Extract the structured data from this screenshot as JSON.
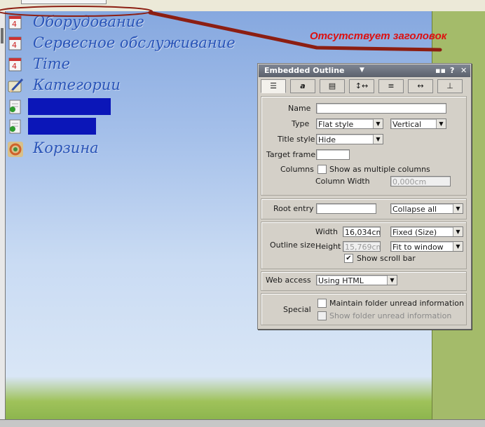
{
  "outline": {
    "items": [
      {
        "label": "Оборудование",
        "icon": "calendar-icon"
      },
      {
        "label": "Сервесное обслуживание",
        "icon": "calendar-icon"
      },
      {
        "label": "Time",
        "icon": "calendar-icon"
      },
      {
        "label": "Категории",
        "icon": "pencil-notebook-icon"
      },
      {
        "label": "",
        "icon": "document-pushpin-icon",
        "redacted": true
      },
      {
        "label": "",
        "icon": "document-pushpin-icon",
        "redacted": true
      },
      {
        "label": "Корзина",
        "icon": "trash-icon"
      }
    ]
  },
  "annotation": {
    "text": "Отсутствует заголовок",
    "color": "#dd1010"
  },
  "panel": {
    "title": "Embedded Outline",
    "tabs": [
      "outline-info-icon",
      "font-icon",
      "border-icon",
      "spacing-icon",
      "lines-icon",
      "width-icon",
      "hide-icon"
    ],
    "name": {
      "label": "Name",
      "value": ""
    },
    "type": {
      "label": "Type",
      "value": "Flat style",
      "orientation": "Vertical"
    },
    "title_style": {
      "label": "Title style",
      "value": "Hide"
    },
    "target_frame": {
      "label": "Target frame",
      "value": ""
    },
    "columns": {
      "label": "Columns",
      "checkbox_label": "Show as multiple columns",
      "checked": false,
      "column_width_label": "Column Width",
      "column_width_value": "0,000cm"
    },
    "root_entry": {
      "label": "Root entry",
      "value": "",
      "collapse": "Collapse all"
    },
    "outline_size": {
      "label": "Outline size",
      "width_label": "Width",
      "width_value": "16,034cm",
      "width_mode": "Fixed (Size)",
      "height_label": "Height",
      "height_value": "15,769cm",
      "height_mode": "Fit to window",
      "scrollbar_label": "Show scroll bar",
      "scrollbar_checked": true
    },
    "web_access": {
      "label": "Web access",
      "value": "Using HTML"
    },
    "special": {
      "label": "Special",
      "maintain_label": "Maintain folder unread information",
      "show_label": "Show folder unread information"
    }
  },
  "colors": {
    "annotation": "#dd1010",
    "outline_text": "#2a55b8",
    "redaction": "#0b16b8"
  }
}
